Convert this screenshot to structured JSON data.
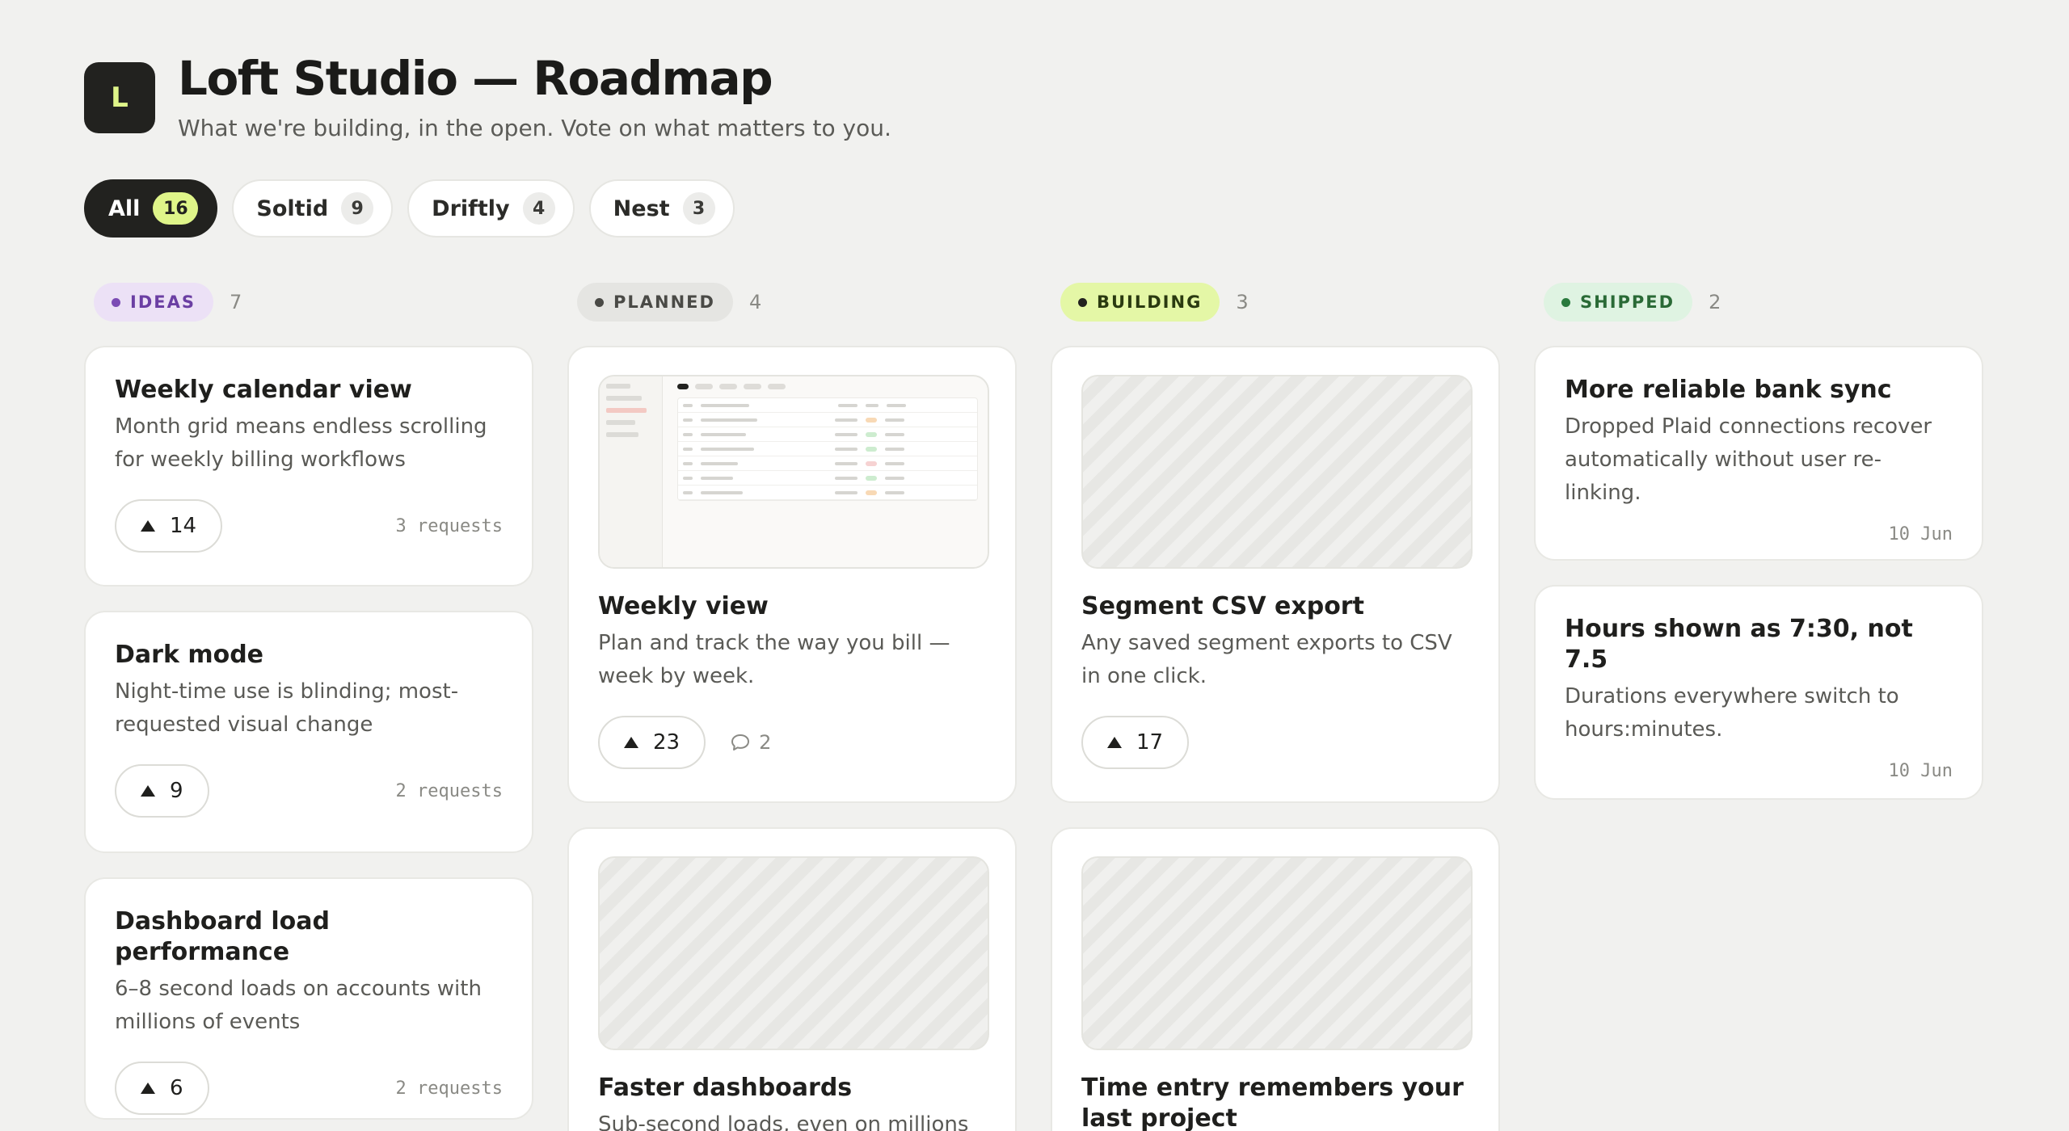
{
  "header": {
    "logo_letter": "L",
    "title": "Loft Studio — Roadmap",
    "subtitle": "What we're building, in the open. Vote on what matters to you."
  },
  "filters": [
    {
      "label": "All",
      "count": "16",
      "active": true
    },
    {
      "label": "Soltid",
      "count": "9"
    },
    {
      "label": "Driftly",
      "count": "4"
    },
    {
      "label": "Nest",
      "count": "3"
    }
  ],
  "columns": {
    "ideas": {
      "status": "IDEAS",
      "count": "7",
      "color": "#7b4bb4",
      "bg": "#ece1f6",
      "cards": [
        {
          "title": "Weekly calendar view",
          "desc": "Month grid means endless scrolling for weekly billing workflows",
          "votes": "14",
          "meta": "3 requests"
        },
        {
          "title": "Dark mode",
          "desc": "Night-time use is blinding; most-requested visual change",
          "votes": "9",
          "meta": "2 requests"
        },
        {
          "title": "Dashboard load performance",
          "desc": "6–8 second loads on accounts with millions of events",
          "votes": "6",
          "meta": "2 requests"
        }
      ]
    },
    "planned": {
      "status": "PLANNED",
      "count": "4",
      "color": "#4a4a46",
      "bg": "#e5e5e2",
      "cards": [
        {
          "title": "Weekly view",
          "desc": "Plan and track the way you bill — week by week.",
          "votes": "23",
          "comments": "2",
          "thumb": "screenshot"
        },
        {
          "title": "Faster dashboards",
          "desc": "Sub-second loads, even on millions of events.",
          "thumb": "placeholder"
        }
      ]
    },
    "building": {
      "status": "BUILDING",
      "count": "3",
      "color": "#2a3a10",
      "bg": "#e4f7a6",
      "cards": [
        {
          "title": "Segment CSV export",
          "desc": "Any saved segment exports to CSV in one click.",
          "votes": "17",
          "thumb": "placeholder"
        },
        {
          "title": "Time entry remembers your last project",
          "thumb": "placeholder"
        }
      ]
    },
    "shipped": {
      "status": "SHIPPED",
      "count": "2",
      "color": "#2a7a3e",
      "bg": "#dff3e2",
      "cards": [
        {
          "title": "More reliable bank sync",
          "desc": "Dropped Plaid connections recover automatically without user re-linking.",
          "meta": "10 Jun"
        },
        {
          "title": "Hours shown as 7:30, not 7.5",
          "desc": "Durations everywhere switch to hours:minutes.",
          "meta": "10 Jun"
        }
      ]
    }
  }
}
